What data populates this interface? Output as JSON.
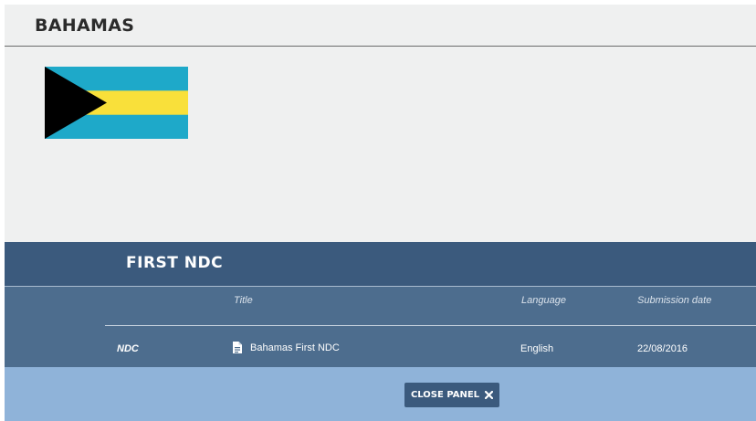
{
  "country": {
    "name": "BAHAMAS",
    "flag": {
      "icon": "bahamas-flag",
      "colors": {
        "aquamarine": "#1ea9c9",
        "gold": "#f9e03a",
        "black": "#000000"
      }
    }
  },
  "ndc_panel": {
    "heading": "FIRST  NDC",
    "columns": {
      "title": "Title",
      "language": "Language",
      "submission_date": "Submission date"
    },
    "rows": [
      {
        "type": "NDC",
        "title": "Bahamas First NDC",
        "title_icon": "document-icon",
        "language": "English",
        "submission_date": "22/08/2016"
      }
    ]
  },
  "footer": {
    "close_label": "CLOSE PANEL",
    "close_icon": "close-icon"
  },
  "colors": {
    "panel_header": "#3b5a7d",
    "panel_body": "#4d6d8e",
    "footer": "#8fb3d9",
    "background": "#eff0f0"
  }
}
